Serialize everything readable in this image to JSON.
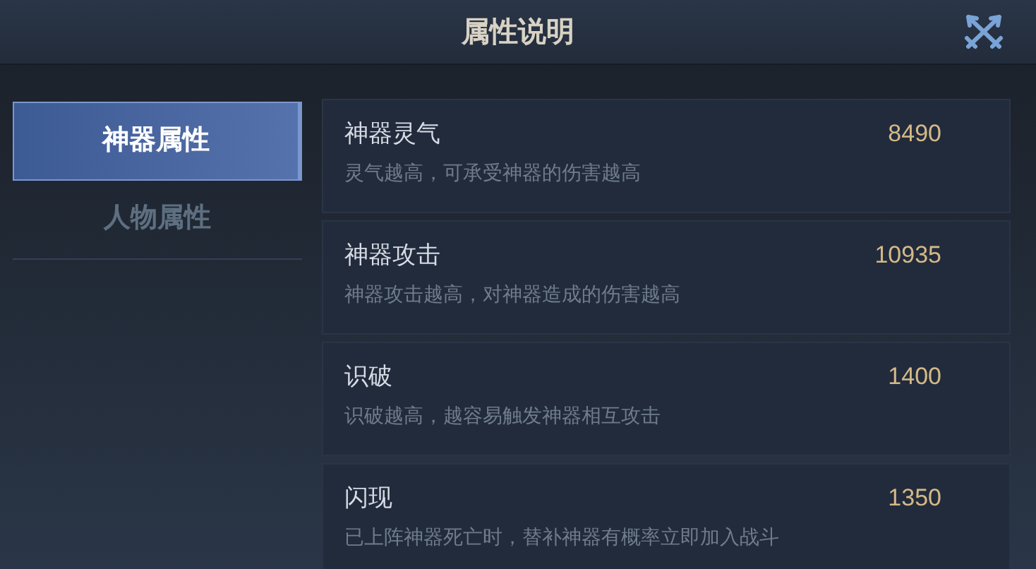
{
  "title": "属性说明",
  "tabs": [
    {
      "label": "神器属性",
      "selected": true
    },
    {
      "label": "人物属性",
      "selected": false
    }
  ],
  "attributes": [
    {
      "name": "神器灵气",
      "value": "8490",
      "description": "灵气越高，可承受神器的伤害越高"
    },
    {
      "name": "神器攻击",
      "value": "10935",
      "description": "神器攻击越高，对神器造成的伤害越高"
    },
    {
      "name": "识破",
      "value": "1400",
      "description": "识破越高，越容易触发神器相互攻击"
    },
    {
      "name": "闪现",
      "value": "1350",
      "description": "已上阵神器死亡时，替补神器有概率立即加入战斗"
    }
  ]
}
